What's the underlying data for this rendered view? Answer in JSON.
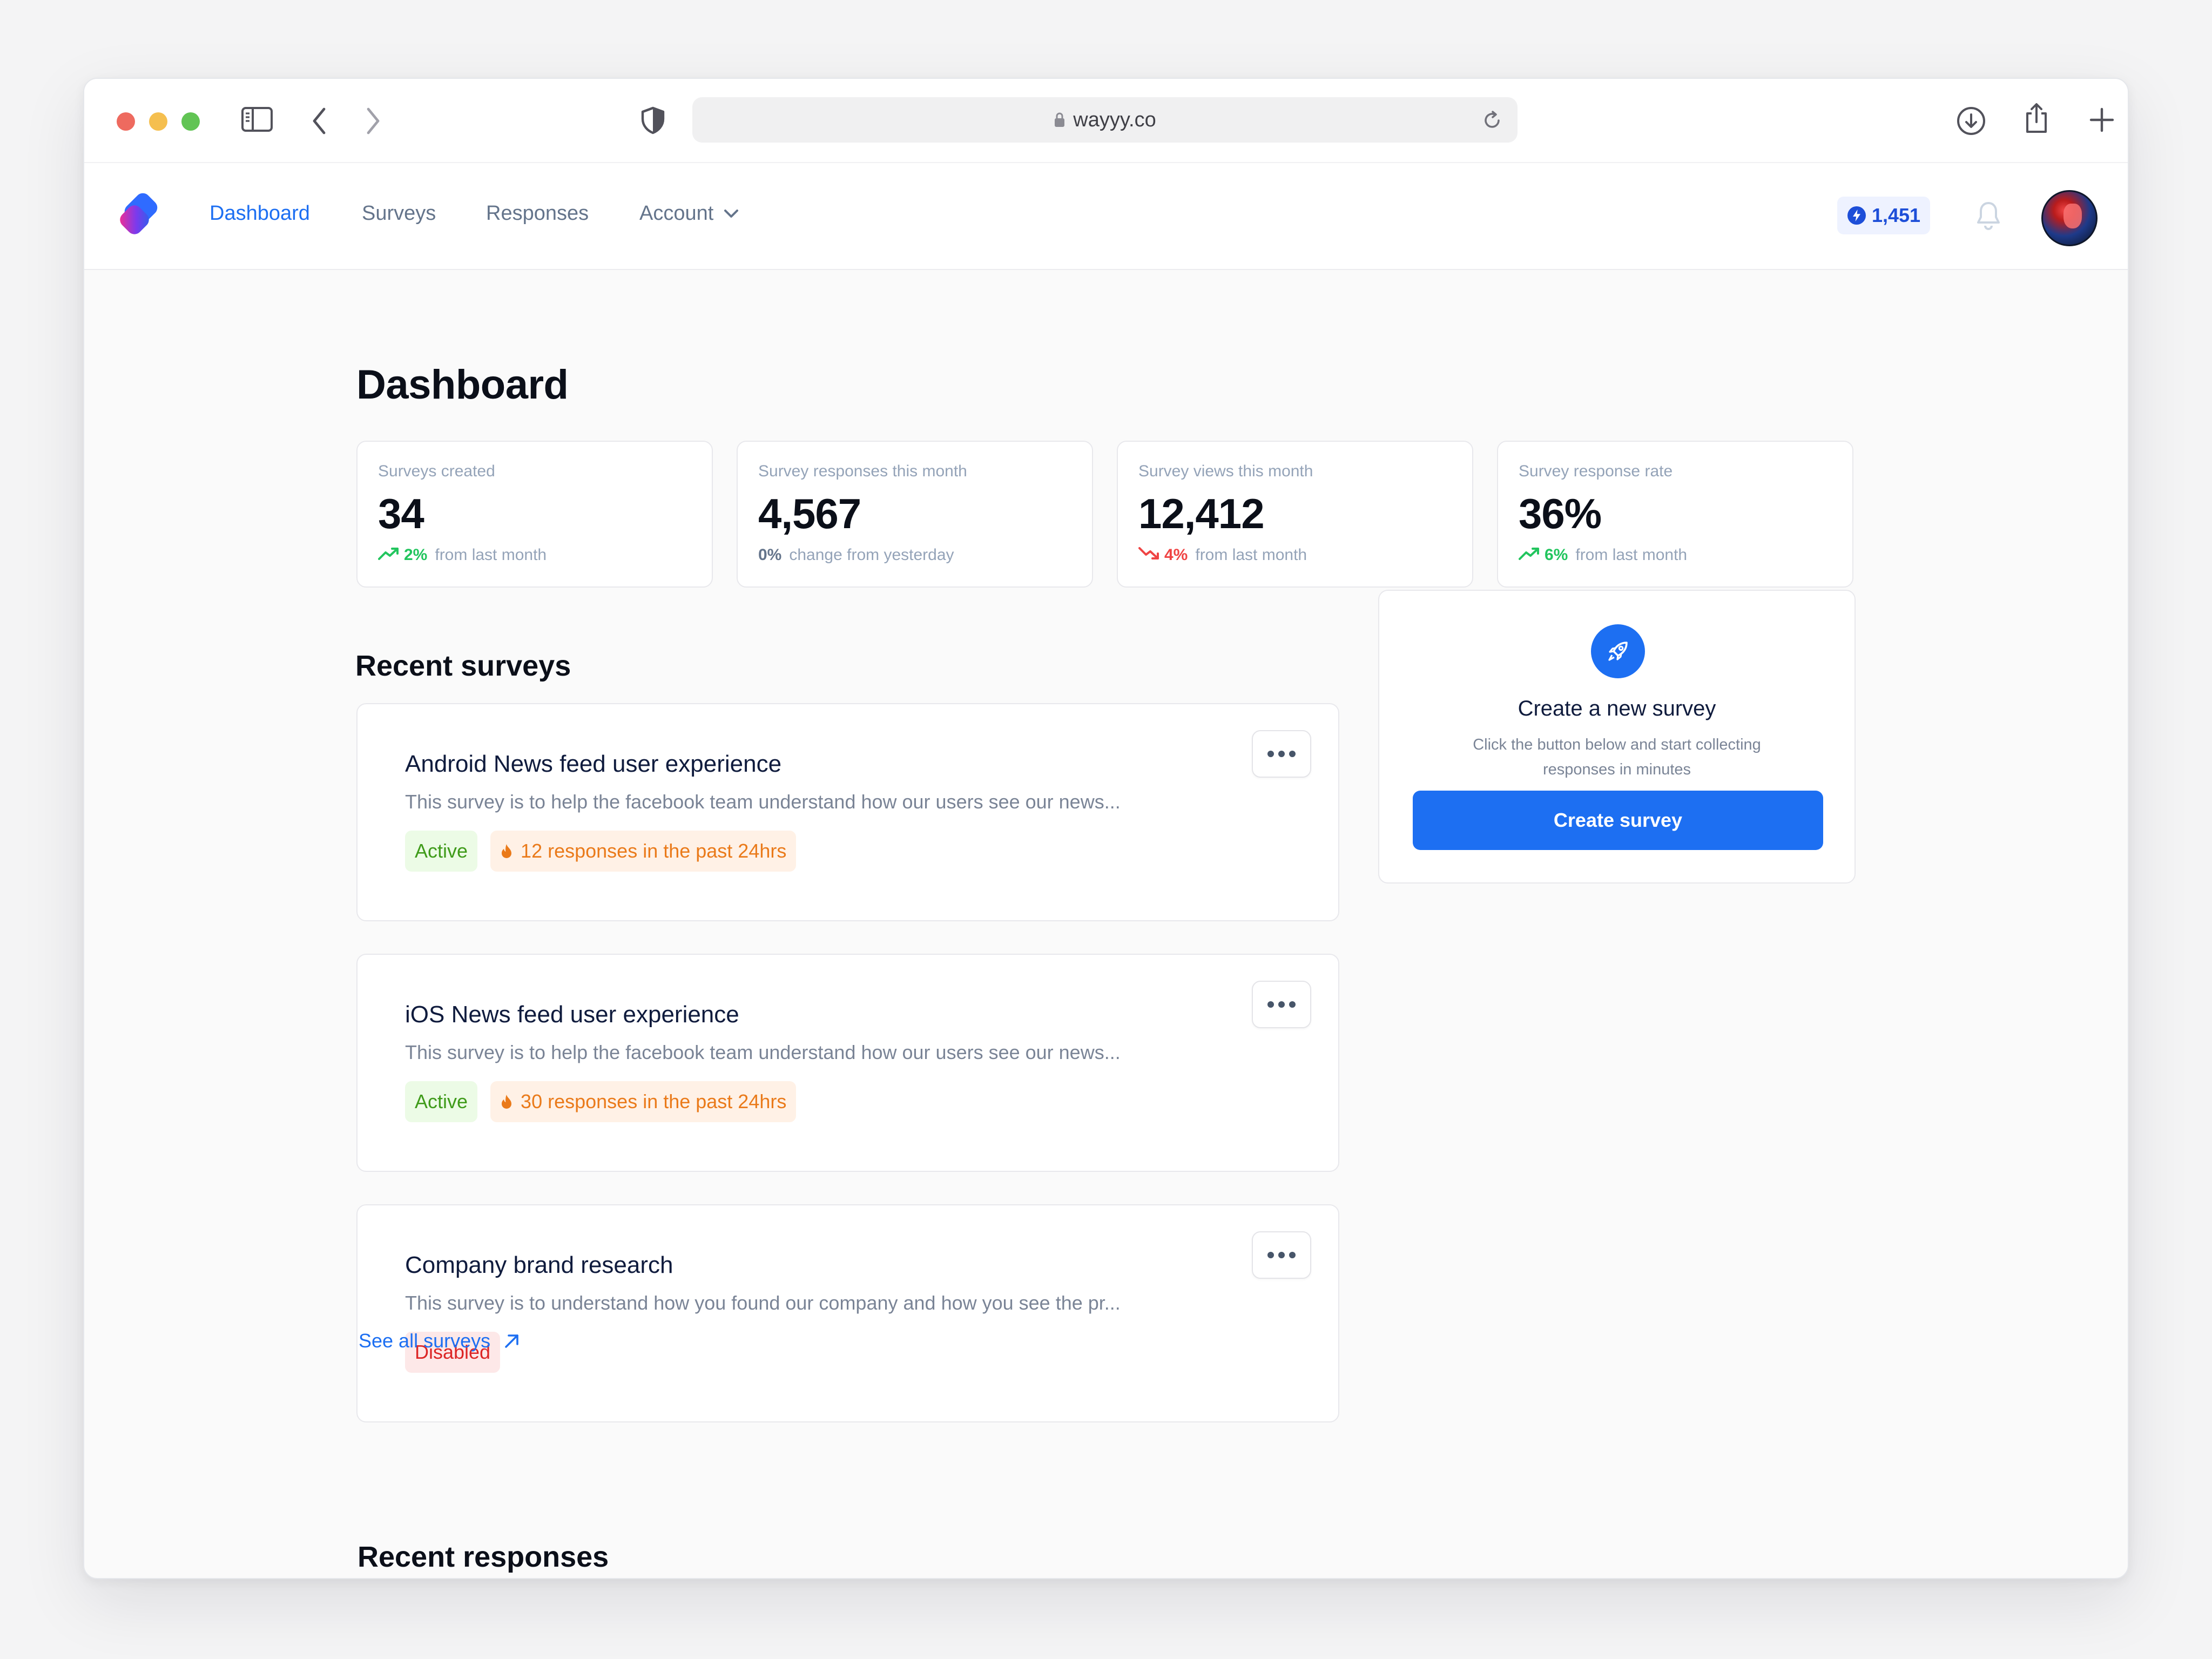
{
  "browser": {
    "url": "wayyy.co"
  },
  "nav": {
    "links": [
      {
        "label": "Dashboard",
        "active": true
      },
      {
        "label": "Surveys",
        "active": false
      },
      {
        "label": "Responses",
        "active": false
      },
      {
        "label": "Account",
        "active": false,
        "dropdown": true
      }
    ],
    "credits": "1,451",
    "accent_color": "#1d6ff2"
  },
  "page": {
    "title": "Dashboard"
  },
  "stats": [
    {
      "label": "Surveys created",
      "value": "34",
      "change": "2%",
      "trend": "up",
      "note": "from last month"
    },
    {
      "label": "Survey responses this month",
      "value": "4,567",
      "change": "0%",
      "trend": "flat",
      "note": "change from yesterday"
    },
    {
      "label": "Survey views this month",
      "value": "12,412",
      "change": "4%",
      "trend": "down",
      "note": "from last month"
    },
    {
      "label": "Survey response rate",
      "value": "36%",
      "change": "6%",
      "trend": "up",
      "note": "from last month"
    }
  ],
  "recent_surveys": {
    "title": "Recent surveys",
    "items": [
      {
        "title": "Android News feed user experience",
        "description": "This survey is to help the facebook team understand how our users see our news...",
        "status": "Active",
        "responses": "12 responses in the past 24hrs"
      },
      {
        "title": "iOS News feed user experience",
        "description": "This survey is to help the facebook team understand how our users see our news...",
        "status": "Active",
        "responses": "30 responses in the past 24hrs"
      },
      {
        "title": "Company brand research",
        "description": "This survey is to understand how you found our company and how you see the pr...",
        "status": "Disabled",
        "responses": ""
      }
    ],
    "see_all": "See all surveys"
  },
  "create_card": {
    "title": "Create a new survey",
    "description": "Click the button below and start collecting responses in minutes",
    "button": "Create survey"
  },
  "recent_responses": {
    "title": "Recent responses"
  }
}
